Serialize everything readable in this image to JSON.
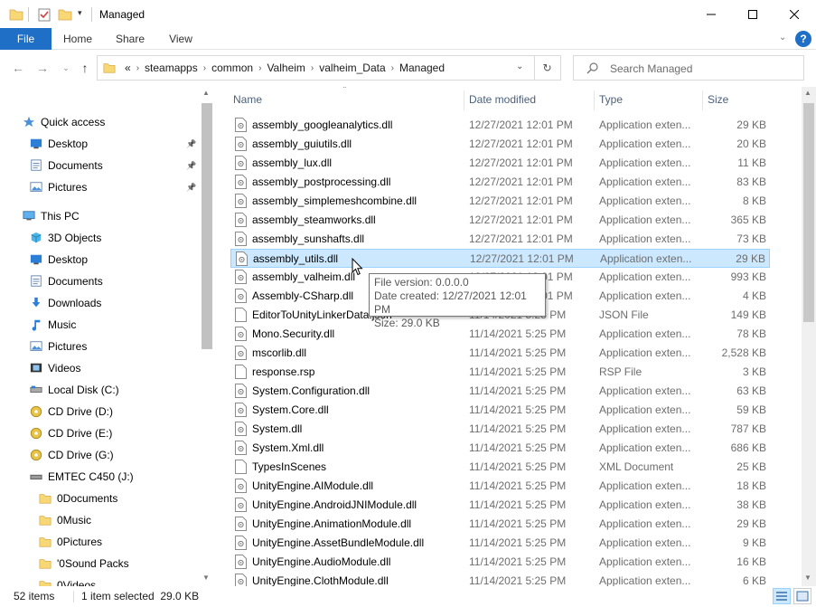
{
  "window": {
    "title": "Managed",
    "minimize_icon": "minimize-icon",
    "maximize_icon": "maximize-icon",
    "close_icon": "close-icon"
  },
  "ribbon": {
    "tabs": [
      {
        "label": "File"
      },
      {
        "label": "Home"
      },
      {
        "label": "Share"
      },
      {
        "label": "View"
      }
    ]
  },
  "address": {
    "overflow": "«",
    "crumbs": [
      "steamapps",
      "common",
      "Valheim",
      "valheim_Data",
      "Managed"
    ]
  },
  "search": {
    "placeholder": "Search Managed"
  },
  "nav": {
    "items": [
      {
        "label": "Quick access",
        "icon": "star-icon"
      },
      {
        "label": "Desktop",
        "icon": "desktop-icon"
      },
      {
        "label": "Documents",
        "icon": "documents-icon"
      },
      {
        "label": "Pictures",
        "icon": "pictures-icon"
      },
      {
        "label": "This PC",
        "icon": "computer-icon"
      },
      {
        "label": "3D Objects",
        "icon": "cube-icon"
      },
      {
        "label": "Desktop",
        "icon": "desktop-icon"
      },
      {
        "label": "Documents",
        "icon": "documents-icon"
      },
      {
        "label": "Downloads",
        "icon": "download-icon"
      },
      {
        "label": "Music",
        "icon": "music-icon"
      },
      {
        "label": "Pictures",
        "icon": "pictures-icon"
      },
      {
        "label": "Videos",
        "icon": "video-icon"
      },
      {
        "label": "Local Disk (C:)",
        "icon": "drive-icon"
      },
      {
        "label": "CD Drive (D:)",
        "icon": "cd-icon"
      },
      {
        "label": "CD Drive (E:)",
        "icon": "cd-icon"
      },
      {
        "label": "CD Drive (G:)",
        "icon": "cd-icon"
      },
      {
        "label": "EMTEC C450 (J:)",
        "icon": "usb-drive-icon"
      },
      {
        "label": "0Documents",
        "icon": "folder-icon"
      },
      {
        "label": "0Music",
        "icon": "folder-icon"
      },
      {
        "label": "0Pictures",
        "icon": "folder-icon"
      },
      {
        "label": "'0Sound Packs",
        "icon": "folder-icon"
      },
      {
        "label": "0Videos",
        "icon": "folder-icon"
      }
    ]
  },
  "columns": {
    "name": "Name",
    "date": "Date modified",
    "type": "Type",
    "size": "Size"
  },
  "files": [
    {
      "name": "assembly_googleanalytics.dll",
      "date": "12/27/2021 12:01 PM",
      "type": "Application exten...",
      "size": "29 KB",
      "icon": "dll-icon"
    },
    {
      "name": "assembly_guiutils.dll",
      "date": "12/27/2021 12:01 PM",
      "type": "Application exten...",
      "size": "20 KB",
      "icon": "dll-icon"
    },
    {
      "name": "assembly_lux.dll",
      "date": "12/27/2021 12:01 PM",
      "type": "Application exten...",
      "size": "11 KB",
      "icon": "dll-icon"
    },
    {
      "name": "assembly_postprocessing.dll",
      "date": "12/27/2021 12:01 PM",
      "type": "Application exten...",
      "size": "83 KB",
      "icon": "dll-icon"
    },
    {
      "name": "assembly_simplemeshcombine.dll",
      "date": "12/27/2021 12:01 PM",
      "type": "Application exten...",
      "size": "8 KB",
      "icon": "dll-icon"
    },
    {
      "name": "assembly_steamworks.dll",
      "date": "12/27/2021 12:01 PM",
      "type": "Application exten...",
      "size": "365 KB",
      "icon": "dll-icon"
    },
    {
      "name": "assembly_sunshafts.dll",
      "date": "12/27/2021 12:01 PM",
      "type": "Application exten...",
      "size": "73 KB",
      "icon": "dll-icon"
    },
    {
      "name": "assembly_utils.dll",
      "date": "12/27/2021 12:01 PM",
      "type": "Application exten...",
      "size": "29 KB",
      "icon": "dll-icon",
      "selected": true
    },
    {
      "name": "assembly_valheim.dll",
      "date": "12/27/2021 12:01 PM",
      "type": "Application exten...",
      "size": "993 KB",
      "icon": "dll-icon"
    },
    {
      "name": "Assembly-CSharp.dll",
      "date": "12/27/2021 12:01 PM",
      "type": "Application exten...",
      "size": "4 KB",
      "icon": "dll-icon"
    },
    {
      "name": "EditorToUnityLinkerData.json",
      "date": "11/14/2021 5:25 PM",
      "type": "JSON File",
      "size": "149 KB",
      "icon": "file-icon"
    },
    {
      "name": "Mono.Security.dll",
      "date": "11/14/2021 5:25 PM",
      "type": "Application exten...",
      "size": "78 KB",
      "icon": "dll-icon"
    },
    {
      "name": "mscorlib.dll",
      "date": "11/14/2021 5:25 PM",
      "type": "Application exten...",
      "size": "2,528 KB",
      "icon": "dll-icon"
    },
    {
      "name": "response.rsp",
      "date": "11/14/2021 5:25 PM",
      "type": "RSP File",
      "size": "3 KB",
      "icon": "file-icon"
    },
    {
      "name": "System.Configuration.dll",
      "date": "11/14/2021 5:25 PM",
      "type": "Application exten...",
      "size": "63 KB",
      "icon": "dll-icon"
    },
    {
      "name": "System.Core.dll",
      "date": "11/14/2021 5:25 PM",
      "type": "Application exten...",
      "size": "59 KB",
      "icon": "dll-icon"
    },
    {
      "name": "System.dll",
      "date": "11/14/2021 5:25 PM",
      "type": "Application exten...",
      "size": "787 KB",
      "icon": "dll-icon"
    },
    {
      "name": "System.Xml.dll",
      "date": "11/14/2021 5:25 PM",
      "type": "Application exten...",
      "size": "686 KB",
      "icon": "dll-icon"
    },
    {
      "name": "TypesInScenes",
      "date": "11/14/2021 5:25 PM",
      "type": "XML Document",
      "size": "25 KB",
      "icon": "file-icon"
    },
    {
      "name": "UnityEngine.AIModule.dll",
      "date": "11/14/2021 5:25 PM",
      "type": "Application exten...",
      "size": "18 KB",
      "icon": "dll-icon"
    },
    {
      "name": "UnityEngine.AndroidJNIModule.dll",
      "date": "11/14/2021 5:25 PM",
      "type": "Application exten...",
      "size": "38 KB",
      "icon": "dll-icon"
    },
    {
      "name": "UnityEngine.AnimationModule.dll",
      "date": "11/14/2021 5:25 PM",
      "type": "Application exten...",
      "size": "29 KB",
      "icon": "dll-icon"
    },
    {
      "name": "UnityEngine.AssetBundleModule.dll",
      "date": "11/14/2021 5:25 PM",
      "type": "Application exten...",
      "size": "9 KB",
      "icon": "dll-icon"
    },
    {
      "name": "UnityEngine.AudioModule.dll",
      "date": "11/14/2021 5:25 PM",
      "type": "Application exten...",
      "size": "16 KB",
      "icon": "dll-icon"
    },
    {
      "name": "UnityEngine.ClothModule.dll",
      "date": "11/14/2021 5:25 PM",
      "type": "Application exten...",
      "size": "6 KB",
      "icon": "dll-icon"
    }
  ],
  "tooltip": {
    "line1": "File version: 0.0.0.0",
    "line2": "Date created: 12/27/2021 12:01 PM",
    "line3": "Size: 29.0 KB"
  },
  "status": {
    "count": "52 items",
    "selection": "1 item selected  29.0 KB"
  },
  "colors": {
    "accent": "#1e6fc5",
    "selection_bg": "#cce8ff",
    "selection_border": "#99d1ff",
    "header_text": "#4c607a"
  }
}
